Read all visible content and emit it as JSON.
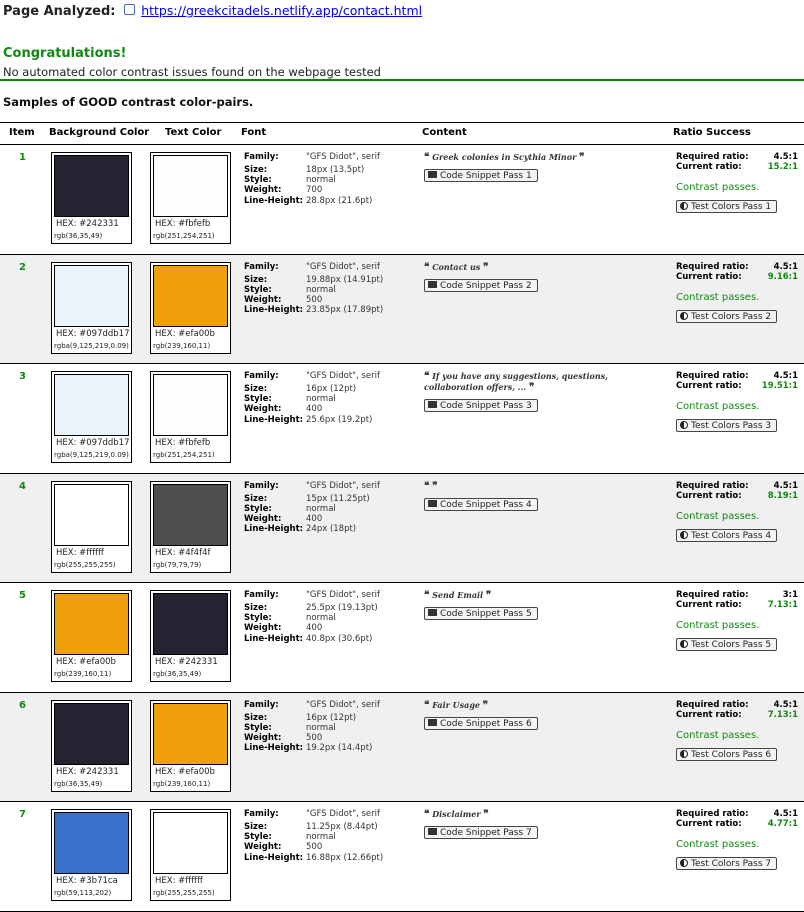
{
  "header": {
    "label": "Page Analyzed:",
    "url": "https://greekcitadels.netlify.app/contact.html"
  },
  "result": {
    "title": "Congratulations!",
    "subtitle": "No automated color contrast issues found on the webpage tested"
  },
  "samples_title": "Samples of GOOD contrast color-pairs.",
  "columns": {
    "item": "Item",
    "background": "Background Color",
    "text": "Text Color",
    "font": "Font",
    "content": "Content",
    "ratio": "Ratio Success"
  },
  "labels": {
    "family": "Family:",
    "size": "Size:",
    "style": "Style:",
    "weight": "Weight:",
    "line_height": "Line-Height:",
    "required": "Required ratio:",
    "current": "Current ratio:",
    "passes": "Contrast passes.",
    "open_quote": "❝",
    "close_quote": "❞"
  },
  "colors": {
    "accent": "#118811",
    "link": "#0000ee",
    "alt_row": "#f0f0f0"
  },
  "rows": [
    {
      "item": "1",
      "bg": {
        "hex": "HEX: #242331",
        "rgb": "rgb(36,35,49)",
        "swatch": "#242331"
      },
      "fg": {
        "hex": "HEX: #fbfefb",
        "rgb": "rgb(251,254,251)",
        "swatch": "#fbfefb"
      },
      "font": {
        "family": "\"GFS Didot\", serif",
        "size": "18px (13.5pt)",
        "style": "normal",
        "weight": "700",
        "line_height": "28.8px (21.6pt)"
      },
      "content": "Greek colonies in Scythia Minor",
      "snippet_btn": "Code Snippet Pass 1",
      "required": "4.5:1",
      "current": "15.2:1",
      "test_btn": "Test Colors Pass 1"
    },
    {
      "item": "2",
      "bg": {
        "hex": "HEX: #097ddb17",
        "rgb": "rgba(9,125,219,0.09)",
        "swatch": "#e8f3fc"
      },
      "fg": {
        "hex": "HEX: #efa00b",
        "rgb": "rgb(239,160,11)",
        "swatch": "#efa00b"
      },
      "font": {
        "family": "\"GFS Didot\", serif",
        "size": "19.88px (14.91pt)",
        "style": "normal",
        "weight": "500",
        "line_height": "23.85px (17.89pt)"
      },
      "content": "Contact us",
      "snippet_btn": "Code Snippet Pass 2",
      "required": "4.5:1",
      "current": "9.16:1",
      "test_btn": "Test Colors Pass 2"
    },
    {
      "item": "3",
      "bg": {
        "hex": "HEX: #097ddb17",
        "rgb": "rgba(9,125,219,0.09)",
        "swatch": "#e8f3fc"
      },
      "fg": {
        "hex": "HEX: #fbfefb",
        "rgb": "rgb(251,254,251)",
        "swatch": "#fbfefb"
      },
      "font": {
        "family": "\"GFS Didot\", serif",
        "size": "16px (12pt)",
        "style": "normal",
        "weight": "400",
        "line_height": "25.6px (19.2pt)"
      },
      "content": "If you have any suggestions, questions, collaboration offers, ...",
      "snippet_btn": "Code Snippet Pass 3",
      "required": "4.5:1",
      "current": "19.51:1",
      "test_btn": "Test Colors Pass 3"
    },
    {
      "item": "4",
      "bg": {
        "hex": "HEX: #ffffff",
        "rgb": "rgb(255,255,255)",
        "swatch": "#ffffff"
      },
      "fg": {
        "hex": "HEX: #4f4f4f",
        "rgb": "rgb(79,79,79)",
        "swatch": "#4f4f4f"
      },
      "font": {
        "family": "\"GFS Didot\", serif",
        "size": "15px (11.25pt)",
        "style": "normal",
        "weight": "400",
        "line_height": "24px (18pt)"
      },
      "content": "",
      "snippet_btn": "Code Snippet Pass 4",
      "required": "4.5:1",
      "current": "8.19:1",
      "test_btn": "Test Colors Pass 4"
    },
    {
      "item": "5",
      "bg": {
        "hex": "HEX: #efa00b",
        "rgb": "rgb(239,160,11)",
        "swatch": "#efa00b"
      },
      "fg": {
        "hex": "HEX: #242331",
        "rgb": "rgb(36,35,49)",
        "swatch": "#242331"
      },
      "font": {
        "family": "\"GFS Didot\", serif",
        "size": "25.5px (19.13pt)",
        "style": "normal",
        "weight": "400",
        "line_height": "40.8px (30.6pt)"
      },
      "content": "Send Email",
      "snippet_btn": "Code Snippet Pass 5",
      "required": "3:1",
      "current": "7.13:1",
      "test_btn": "Test Colors Pass 5"
    },
    {
      "item": "6",
      "bg": {
        "hex": "HEX: #242331",
        "rgb": "rgb(36,35,49)",
        "swatch": "#242331"
      },
      "fg": {
        "hex": "HEX: #efa00b",
        "rgb": "rgb(239,160,11)",
        "swatch": "#efa00b"
      },
      "font": {
        "family": "\"GFS Didot\", serif",
        "size": "16px (12pt)",
        "style": "normal",
        "weight": "500",
        "line_height": "19.2px (14.4pt)"
      },
      "content": "Fair Usage",
      "snippet_btn": "Code Snippet Pass 6",
      "required": "4.5:1",
      "current": "7.13:1",
      "test_btn": "Test Colors Pass 6"
    },
    {
      "item": "7",
      "bg": {
        "hex": "HEX: #3b71ca",
        "rgb": "rgb(59,113,202)",
        "swatch": "#3b71ca"
      },
      "fg": {
        "hex": "HEX: #ffffff",
        "rgb": "rgb(255,255,255)",
        "swatch": "#ffffff"
      },
      "font": {
        "family": "\"GFS Didot\", serif",
        "size": "11.25px (8.44pt)",
        "style": "normal",
        "weight": "500",
        "line_height": "16.88px (12.66pt)"
      },
      "content": "Disclaimer",
      "snippet_btn": "Code Snippet Pass 7",
      "required": "4.5:1",
      "current": "4.77:1",
      "test_btn": "Test Colors Pass 7"
    }
  ]
}
